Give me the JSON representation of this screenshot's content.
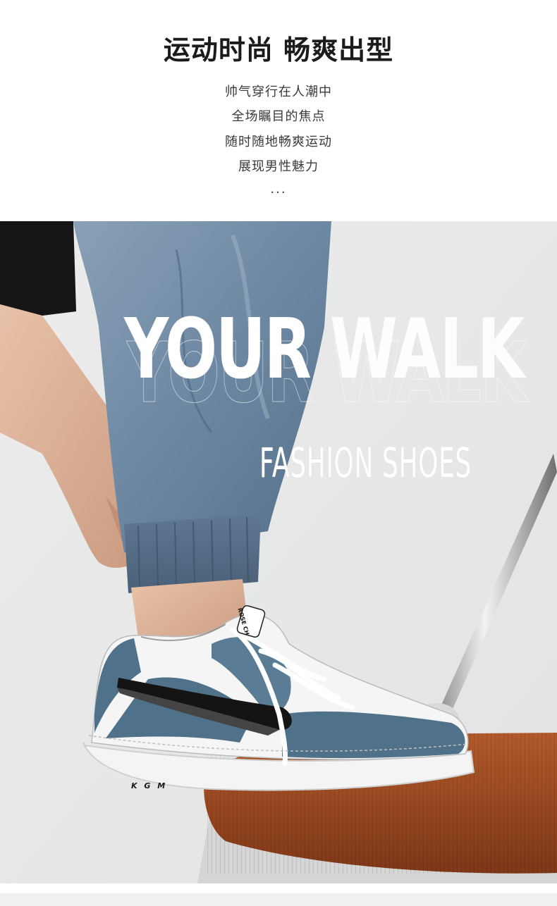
{
  "header": {
    "headline": "运动时尚 畅爽出型",
    "lines": [
      "帅气穿行在人潮中",
      "全场瞩目的焦点",
      "随时随地畅爽运动",
      "展现男性魅力"
    ],
    "ellipsis": "..."
  },
  "banner": {
    "title_word_1": "YOUR",
    "title_word_2": "WALK",
    "subtitle": "FASHION SHOES",
    "shoe_tag_text": "ROSE CH",
    "sole_logo": "K G M"
  },
  "colors": {
    "background": "#e9e9ea",
    "denim": "#5f7a95",
    "suede_blue": "#4c6f87",
    "swoosh": "#151515",
    "cushion": "#9a4a22"
  }
}
